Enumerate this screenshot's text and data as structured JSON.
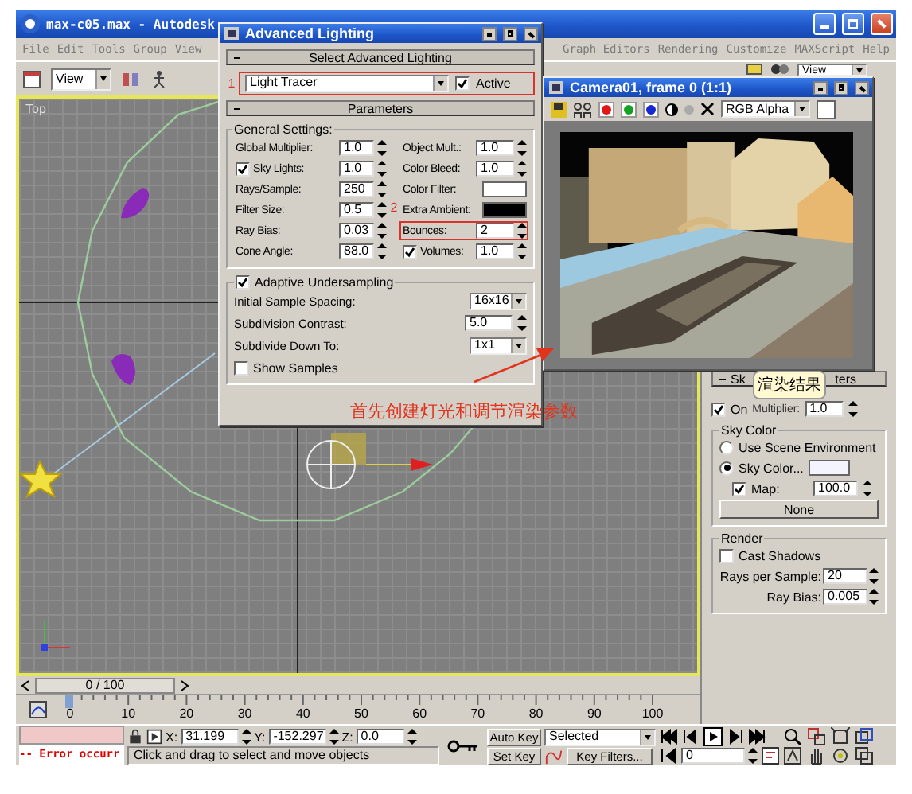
{
  "main_window": {
    "title": "max-c05.max - Autodesk"
  },
  "menu": [
    "File",
    "Edit",
    "Tools",
    "Group",
    "View",
    "Graph Editors",
    "Rendering",
    "Customize",
    "MAXScript",
    "Help"
  ],
  "toolbar": {
    "view_dropdowns": [
      "View",
      "View"
    ]
  },
  "viewport": {
    "label": "Top"
  },
  "advanced_lighting": {
    "title": "Advanced Lighting",
    "select_rollout": "Select Advanced Lighting",
    "plugin": {
      "callout": "1",
      "value": "Light Tracer",
      "highlighted": true
    },
    "active": {
      "label": "Active",
      "checked": true
    },
    "parameters_rollout": "Parameters",
    "general_settings": "General Settings:",
    "rows": [
      {
        "left": {
          "kind": "spinner",
          "label": "Global Multiplier:",
          "value": "1.0"
        },
        "right": {
          "kind": "spinner",
          "label": "Object Mult.:",
          "value": "1.0",
          "highlighted": false
        }
      },
      {
        "left": {
          "kind": "check-spinner",
          "label": "Sky Lights:",
          "checked": true,
          "value": "1.0"
        },
        "right": {
          "kind": "spinner",
          "label": "Color Bleed:",
          "value": "1.0",
          "highlighted": false
        }
      },
      {
        "left": {
          "kind": "spinner",
          "label": "Rays/Sample:",
          "value": "250"
        },
        "right": {
          "kind": "swatch",
          "label": "Color Filter:",
          "color": "#ffffff",
          "highlighted": false
        }
      },
      {
        "left": {
          "kind": "spinner",
          "label": "Filter Size:",
          "value": "0.5"
        },
        "callout": "2",
        "right": {
          "kind": "swatch",
          "label": "Extra Ambient:",
          "color": "#000000",
          "highlighted": false
        }
      },
      {
        "left": {
          "kind": "spinner",
          "label": "Ray Bias:",
          "value": "0.03"
        },
        "right": {
          "kind": "spinner",
          "label": "Bounces:",
          "value": "2",
          "highlighted": true
        }
      },
      {
        "left": {
          "kind": "spinner",
          "label": "Cone Angle:",
          "value": "88.0"
        },
        "right": {
          "kind": "check-spinner",
          "label": "Volumes:",
          "checked": true,
          "value": "1.0",
          "highlighted": false
        }
      }
    ],
    "adaptive": {
      "label": "Adaptive Undersampling",
      "checked": true
    },
    "adaptive_rows": [
      {
        "kind": "dropdown",
        "label": "Initial Sample Spacing:",
        "value": "16x16"
      },
      {
        "kind": "spinner",
        "label": "Subdivision Contrast:",
        "value": "5.0"
      },
      {
        "kind": "dropdown",
        "label": "Subdivide Down To:",
        "value": "1x1"
      }
    ],
    "show_samples": {
      "label": "Show Samples",
      "checked": false
    }
  },
  "camera_window": {
    "title": "Camera01, frame 0 (1:1)",
    "channels": [
      {
        "color": "#e01818"
      },
      {
        "color": "#14a020"
      },
      {
        "color": "#1828d0"
      }
    ],
    "channel_dropdown": "RGB Alpha"
  },
  "tooltip": "渲染结果",
  "annotation": "首先创建灯光和调节渲染参数",
  "command_panel": {
    "rollout_left": "Sk",
    "rollout_right": "ters",
    "on": {
      "label": "On",
      "checked": true
    },
    "multiplier_label": "Multiplier:",
    "multiplier": "1.0",
    "sky_color_group": "Sky Color",
    "sky_options": [
      {
        "label": "Use Scene Environment",
        "selected": false
      },
      {
        "label": "Sky Color...",
        "selected": true
      }
    ],
    "sky_swatch": {
      "color": "#f4f4ff"
    },
    "map": {
      "label": "Map:",
      "checked": true,
      "value": "100.0"
    },
    "map_button": "None",
    "render_group": "Render",
    "cast_shadows": {
      "label": "Cast Shadows",
      "checked": false
    },
    "rays_per_sample": {
      "label": "Rays per Sample:",
      "value": "20"
    },
    "ray_bias": {
      "label": "Ray Bias:",
      "value": "0.005"
    }
  },
  "time_slider": {
    "position": "0 / 100",
    "ticks": [
      "0",
      "10",
      "20",
      "30",
      "40",
      "50",
      "60",
      "70",
      "80",
      "90",
      "100"
    ]
  },
  "status": {
    "error": "-- Error occurr",
    "coords": [
      {
        "label": "X:",
        "value": "31.199"
      },
      {
        "label": "Y:",
        "value": "-152.297"
      },
      {
        "label": "Z:",
        "value": "0.0"
      }
    ],
    "prompt": "Click and drag to select and move objects",
    "auto_key": "Auto Key",
    "key_mode": "Selected",
    "set_key": "Set Key",
    "key_filters": "Key Filters...",
    "frame": "0"
  }
}
